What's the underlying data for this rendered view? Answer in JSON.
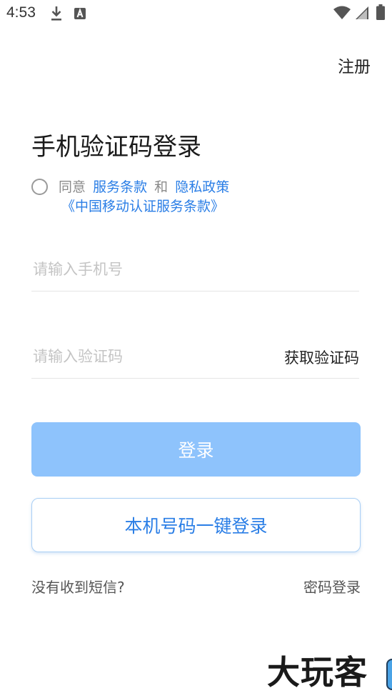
{
  "status_bar": {
    "time": "4:53",
    "icons": [
      "download-icon",
      "keyboard-icon",
      "wifi-icon",
      "signal-icon",
      "battery-icon"
    ]
  },
  "header": {
    "register_label": "注册"
  },
  "main": {
    "title": "手机验证码登录",
    "agreement": {
      "agree_prefix": "同意",
      "terms_link": "服务条款",
      "conjunction": "和",
      "privacy_link": "隐私政策",
      "cmcc_terms_link": "《中国移动认证服务条款》"
    },
    "phone_input": {
      "placeholder": "请输入手机号",
      "value": ""
    },
    "code_input": {
      "placeholder": "请输入验证码",
      "value": ""
    },
    "get_code_label": "获取验证码",
    "login_button_label": "登录",
    "onekey_login_label": "本机号码一键登录",
    "no_sms_label": "没有收到短信?",
    "password_login_label": "密码登录"
  },
  "watermark": {
    "text": "大玩客"
  },
  "colors": {
    "accent": "#2a7ee6",
    "login_button_bg": "#8ec3fc",
    "placeholder": "#c4c4c4"
  }
}
